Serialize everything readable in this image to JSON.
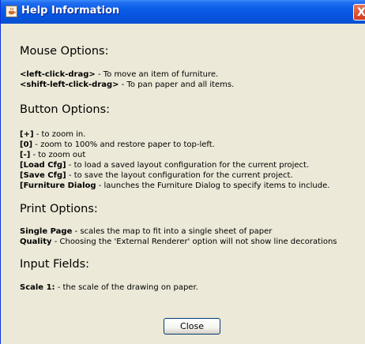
{
  "window": {
    "title": "Help Information",
    "close_glyph": "X"
  },
  "sections": {
    "mouse": {
      "heading": "Mouse Options:",
      "items": [
        {
          "key": "<left-click-drag>",
          "desc": " - To move an item of furniture."
        },
        {
          "key": "<shift-left-click-drag>",
          "desc": " - To pan paper and all items."
        }
      ]
    },
    "buttons": {
      "heading": "Button Options:",
      "items": [
        {
          "key": "[+]",
          "desc": " - to zoom in."
        },
        {
          "key": "[0]",
          "desc": " - zoom to 100% and restore paper to top-left."
        },
        {
          "key": "[-]",
          "desc": " - to zoom out"
        },
        {
          "key": "[Load Cfg]",
          "desc": " - to load a saved layout configuration for the current project."
        },
        {
          "key": "[Save Cfg]",
          "desc": " - to save the layout configuration for the current project."
        },
        {
          "key": "[Furniture Dialog",
          "desc": " - launches the Furniture Dialog to specify items to include."
        }
      ]
    },
    "print": {
      "heading": "Print Options:",
      "items": [
        {
          "key": "Single Page",
          "desc": " - scales the map to fit into a single sheet of paper"
        },
        {
          "key": "Quality",
          "desc": " - Choosing the 'External Renderer' option will not show line decorations"
        }
      ]
    },
    "input": {
      "heading": "Input Fields:",
      "items": [
        {
          "key": "Scale 1:",
          "desc": " - the scale of the drawing on paper."
        }
      ]
    }
  },
  "footer": {
    "close_label": "Close"
  },
  "colors": {
    "titlebar": "#0a5ce6",
    "window_bg": "#ece9d8",
    "close_red": "#d13b1d"
  }
}
